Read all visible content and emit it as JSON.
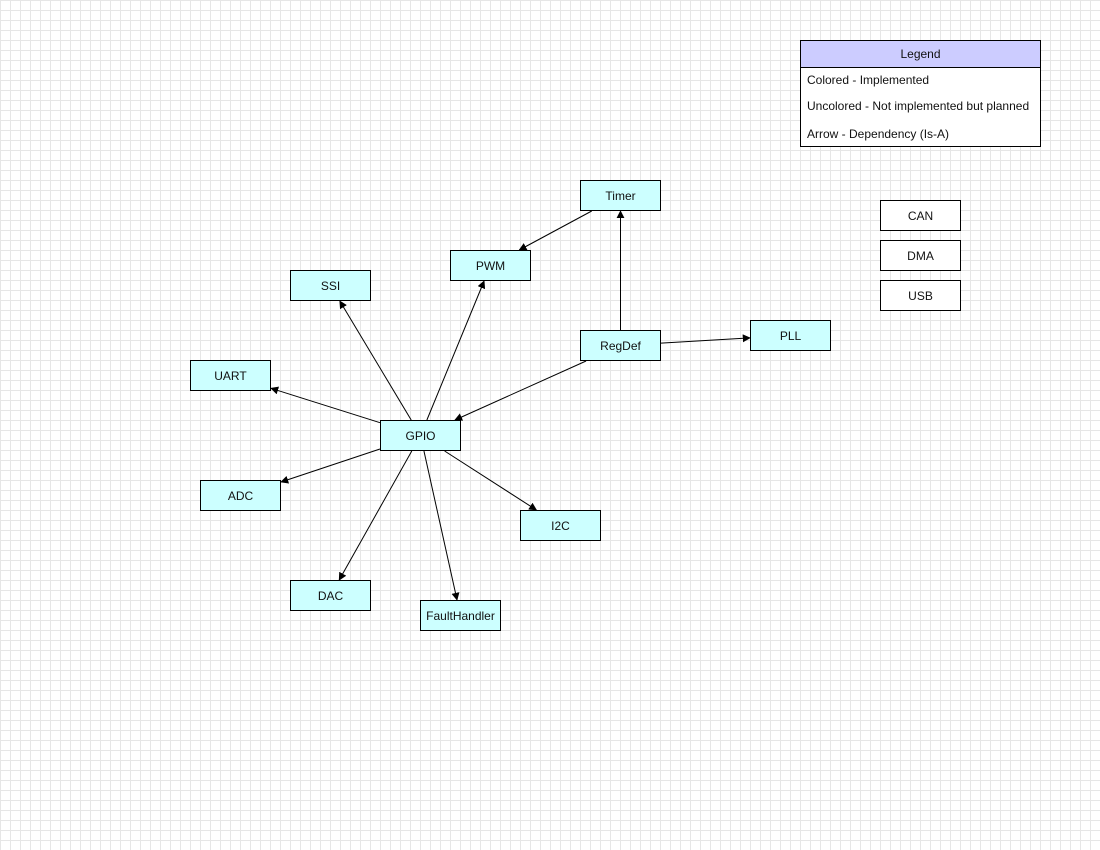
{
  "legend": {
    "title": "Legend",
    "items": [
      "Colored - Implemented",
      "Uncolored - Not implemented but planned",
      "Arrow - Dependency (Is-A)"
    ]
  },
  "colors": {
    "implemented": "#ccffff",
    "planned": "#ffffff",
    "legend_header": "#ccccff",
    "grid": "#e6e6e6",
    "edge": "#000000"
  },
  "nodes": {
    "timer": "Timer",
    "pwm": "PWM",
    "ssi": "SSI",
    "regdef": "RegDef",
    "pll": "PLL",
    "uart": "UART",
    "gpio": "GPIO",
    "adc": "ADC",
    "i2c": "I2C",
    "dac": "DAC",
    "faulthandler": "FaultHandler",
    "can": "CAN",
    "dma": "DMA",
    "usb": "USB"
  },
  "edges": [
    {
      "from": "timer",
      "to": "pwm"
    },
    {
      "from": "regdef",
      "to": "timer"
    },
    {
      "from": "regdef",
      "to": "pll"
    },
    {
      "from": "regdef",
      "to": "gpio"
    },
    {
      "from": "gpio",
      "to": "pwm"
    },
    {
      "from": "gpio",
      "to": "ssi"
    },
    {
      "from": "gpio",
      "to": "uart"
    },
    {
      "from": "gpio",
      "to": "adc"
    },
    {
      "from": "gpio",
      "to": "dac"
    },
    {
      "from": "gpio",
      "to": "faulthandler"
    },
    {
      "from": "gpio",
      "to": "i2c"
    }
  ]
}
